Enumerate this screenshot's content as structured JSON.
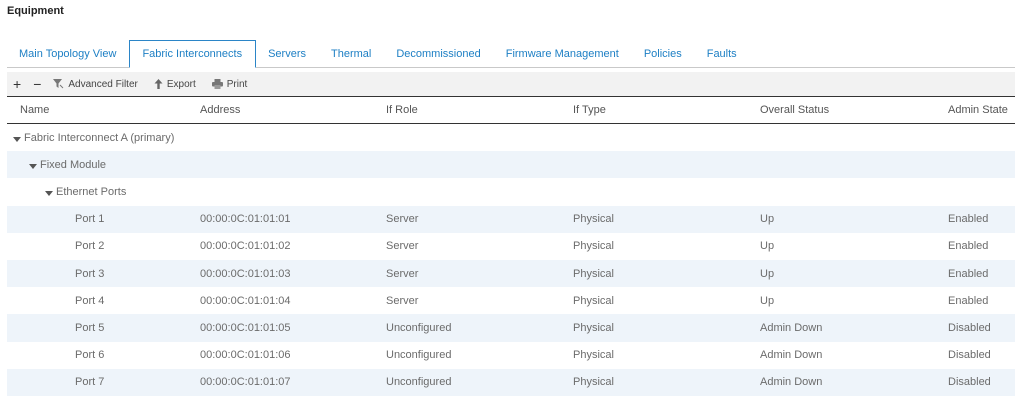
{
  "page": {
    "title": "Equipment"
  },
  "tabs": [
    {
      "label": "Main Topology View"
    },
    {
      "label": "Fabric Interconnects"
    },
    {
      "label": "Servers"
    },
    {
      "label": "Thermal"
    },
    {
      "label": "Decommissioned"
    },
    {
      "label": "Firmware Management"
    },
    {
      "label": "Policies"
    },
    {
      "label": "Faults"
    }
  ],
  "active_tab": "Fabric Interconnects",
  "toolbar": {
    "add_label": "+",
    "remove_label": "−",
    "filter_label": "Advanced Filter",
    "export_label": "Export",
    "print_label": "Print"
  },
  "table": {
    "columns": [
      "Name",
      "Address",
      "If Role",
      "If Type",
      "Overall Status",
      "Admin State"
    ],
    "tree": [
      {
        "label": "Fabric Interconnect A (primary)"
      },
      {
        "label": "Fixed Module"
      },
      {
        "label": "Ethernet Ports"
      }
    ],
    "rows": [
      {
        "name": "Port 1",
        "address": "00:00:0C:01:01:01",
        "role": "Server",
        "type": "Physical",
        "status": "Up",
        "admin": "Enabled"
      },
      {
        "name": "Port 2",
        "address": "00:00:0C:01:01:02",
        "role": "Server",
        "type": "Physical",
        "status": "Up",
        "admin": "Enabled"
      },
      {
        "name": "Port 3",
        "address": "00:00:0C:01:01:03",
        "role": "Server",
        "type": "Physical",
        "status": "Up",
        "admin": "Enabled"
      },
      {
        "name": "Port 4",
        "address": "00:00:0C:01:01:04",
        "role": "Server",
        "type": "Physical",
        "status": "Up",
        "admin": "Enabled"
      },
      {
        "name": "Port 5",
        "address": "00:00:0C:01:01:05",
        "role": "Unconfigured",
        "type": "Physical",
        "status": "Admin Down",
        "admin": "Disabled"
      },
      {
        "name": "Port 6",
        "address": "00:00:0C:01:01:06",
        "role": "Unconfigured",
        "type": "Physical",
        "status": "Admin Down",
        "admin": "Disabled"
      },
      {
        "name": "Port 7",
        "address": "00:00:0C:01:01:07",
        "role": "Unconfigured",
        "type": "Physical",
        "status": "Admin Down",
        "admin": "Disabled"
      }
    ]
  },
  "colors": {
    "accent": "#1d7fc4",
    "row_alt": "#eef4fa",
    "toolbar_bg": "#f2f2f2"
  }
}
